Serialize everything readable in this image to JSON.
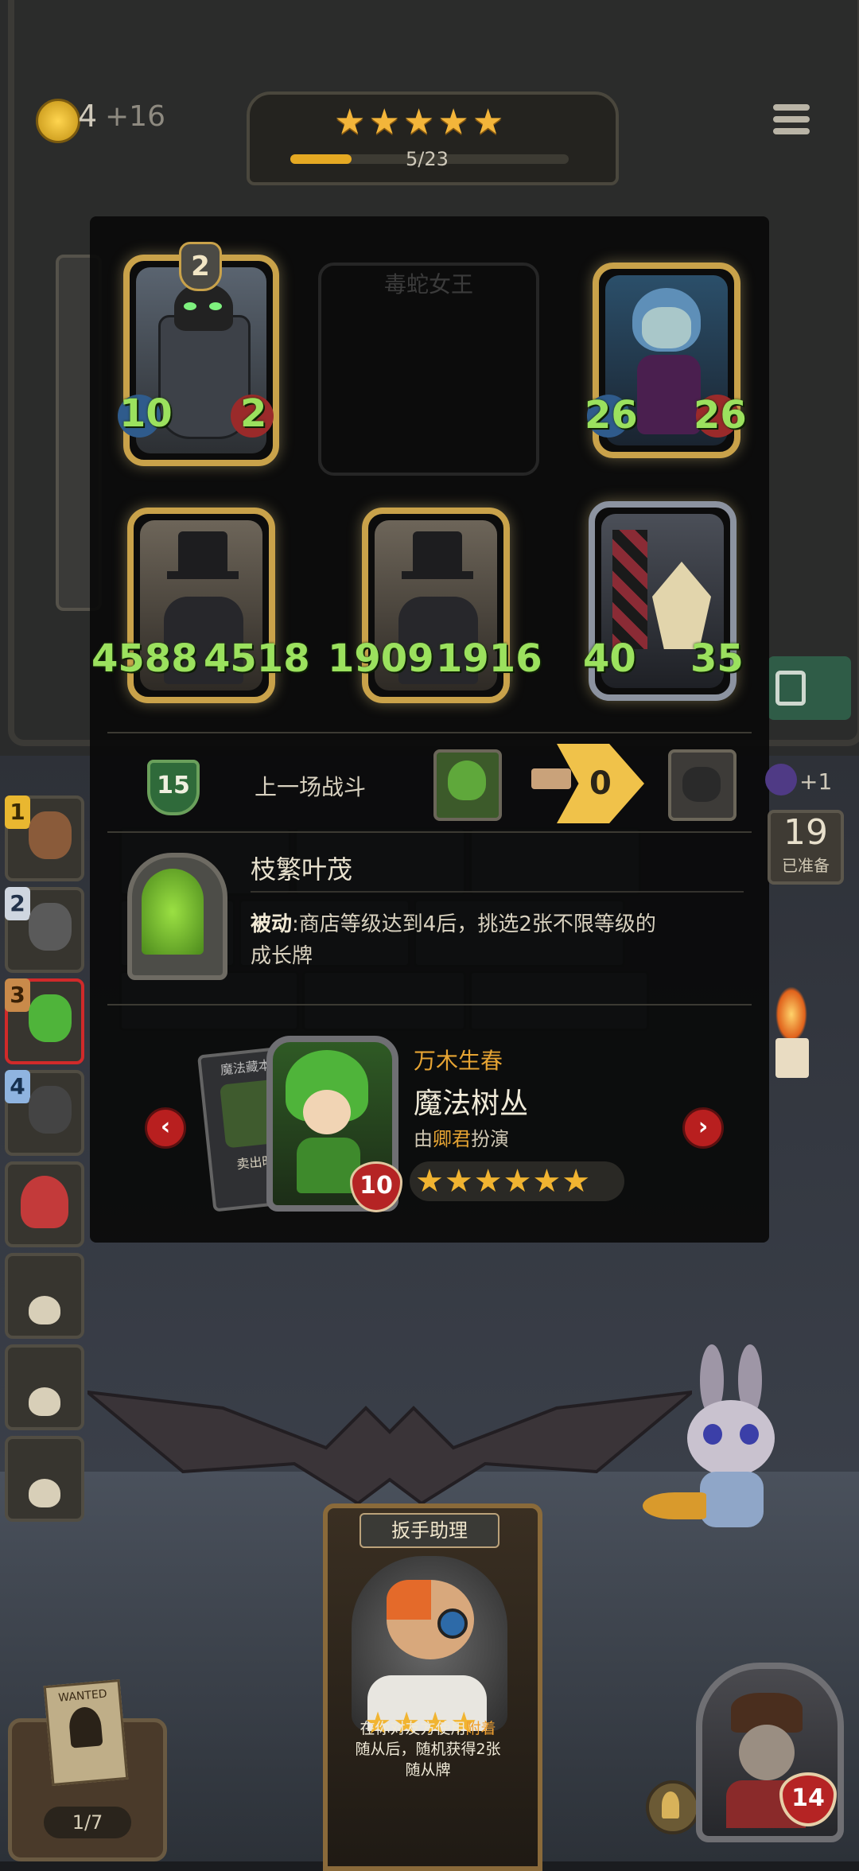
{
  "top_bar": {
    "gold": "4",
    "gold_income": "+16",
    "stars": 5,
    "progress_text": "5/23",
    "progress_fraction": 0.22
  },
  "board": {
    "cards": [
      {
        "level": "2",
        "attack": "10",
        "health": "2"
      },
      {
        "ghost_name": "毒蛇女王"
      },
      {
        "attack": "26",
        "health": "26"
      },
      {
        "attack": "4588",
        "health": "4518"
      },
      {
        "attack": "1909",
        "health": "1916"
      },
      {
        "attack": "40",
        "health": "35"
      }
    ]
  },
  "battle": {
    "level": "15",
    "label": "上一场战斗",
    "damage": "0",
    "moon_bonus": "+1",
    "ready_count": "19",
    "ready_label": "已准备"
  },
  "ability": {
    "title": "枝繁叶茂",
    "desc_prefix": "被动",
    "desc_line1": ":商店等级达到4后，挑选2张不限等级的",
    "desc_line2": "成长牌"
  },
  "hero": {
    "subtitle": "万木生春",
    "name": "魔法树丛",
    "by_prefix": "由",
    "actor": "卿君",
    "by_suffix": "扮演",
    "level": "10",
    "stars": 6,
    "side_card_title": "魔法藏本",
    "side_card_text": "卖出时"
  },
  "sidebar": {
    "ranks": [
      "1",
      "2",
      "3",
      "4"
    ]
  },
  "shop_card": {
    "title": "扳手助理",
    "stars": 4,
    "line1_a": "在你对友方使用",
    "line1_b": "附着",
    "line2": "随从后，随机获得2张",
    "line3": "随从牌"
  },
  "bottom": {
    "wanted_count": "1/7",
    "player_health": "14"
  },
  "colors": {
    "gold": "#f3b53a",
    "stat_green": "#9be15e",
    "accent_orange": "#f0a030",
    "red_button": "#b81f1f"
  }
}
